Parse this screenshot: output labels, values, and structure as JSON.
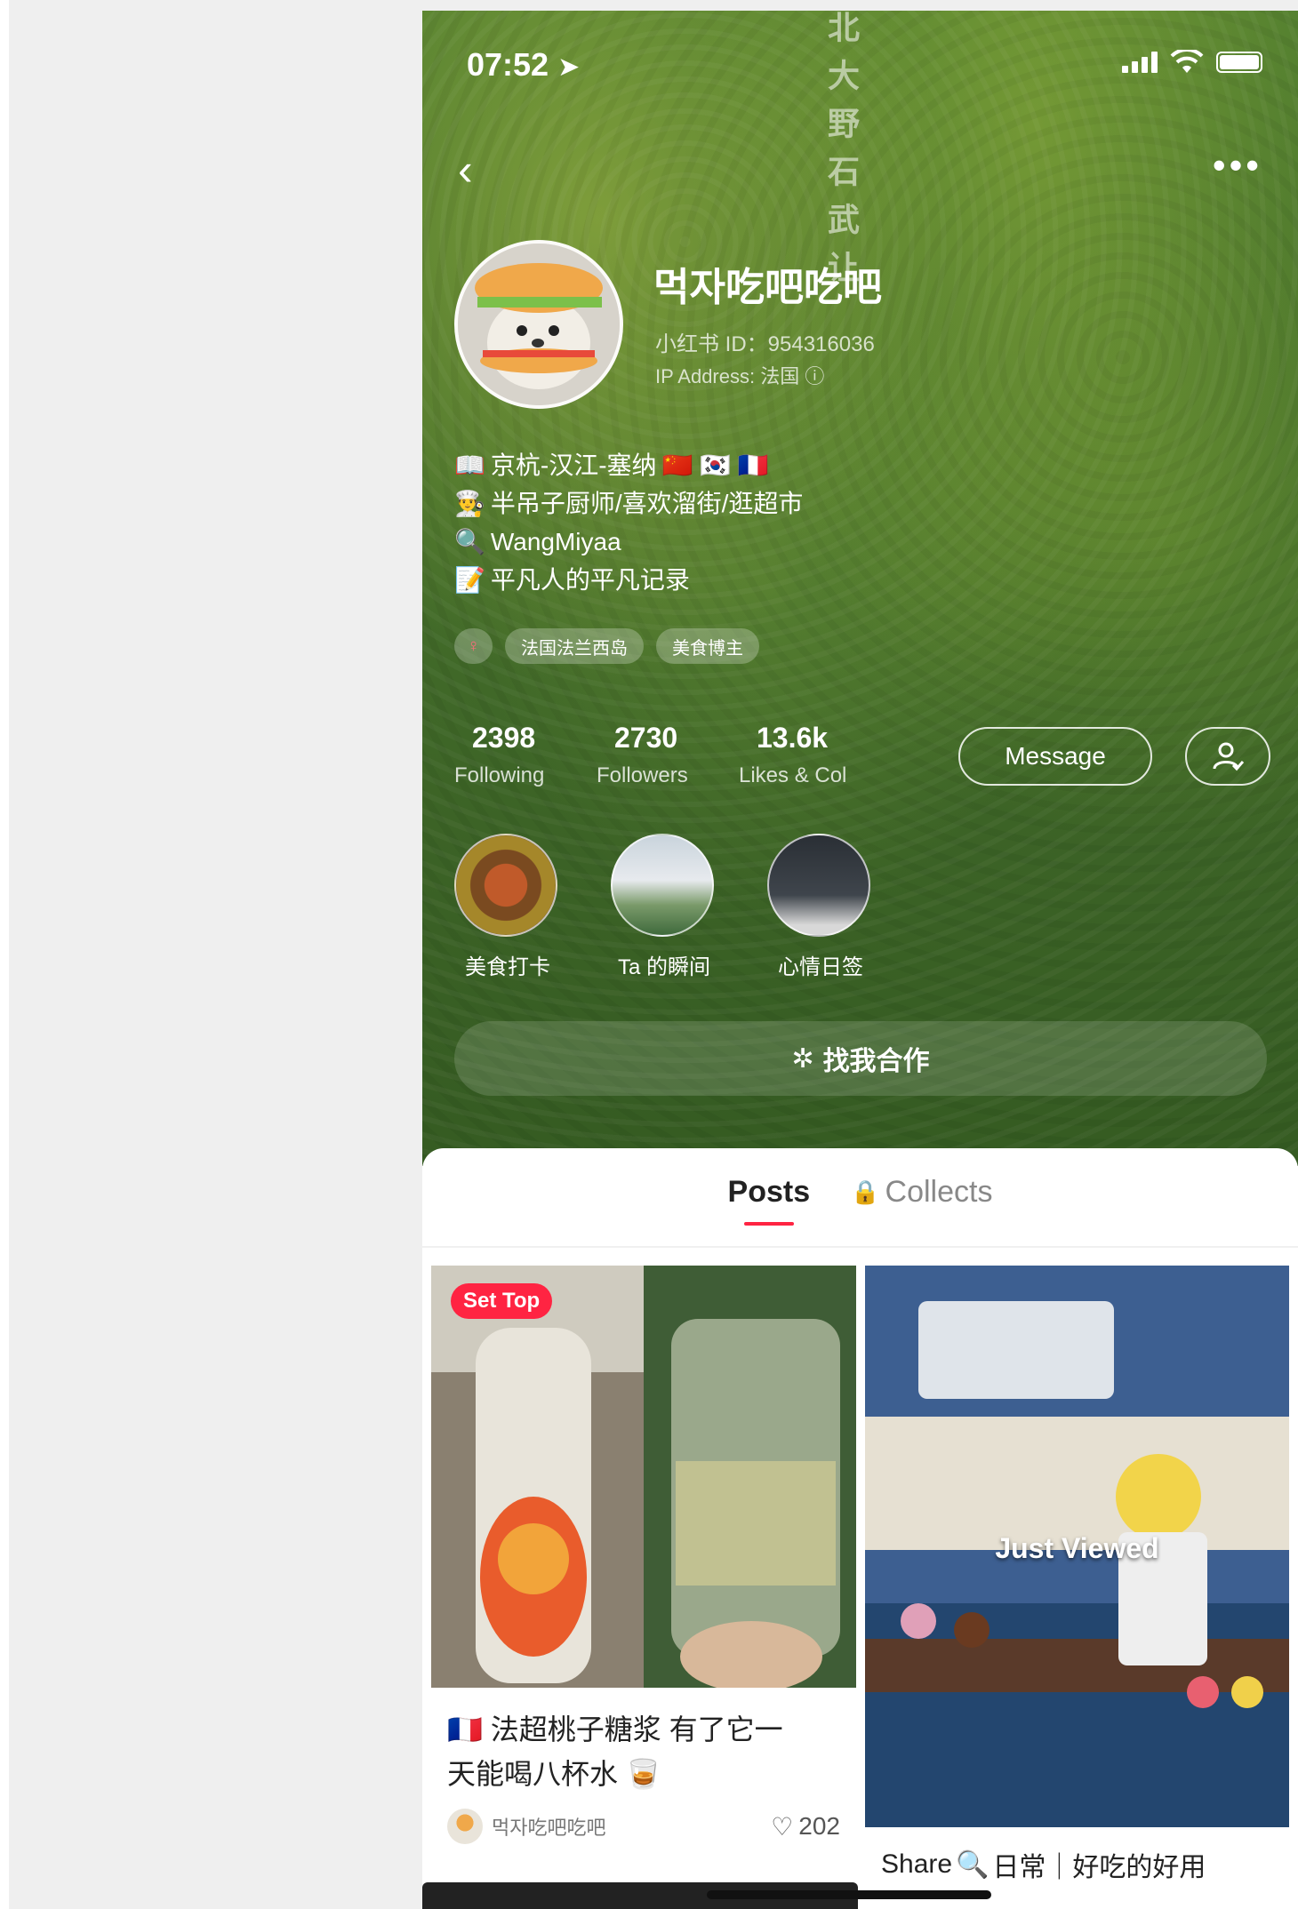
{
  "status": {
    "time": "07:52"
  },
  "poster": {
    "text": "北 大 野 石 武 让"
  },
  "profile": {
    "nickname": "먹자吃吧吃吧",
    "red_id": "小红书 ID：954316036",
    "ip": "IP Address: 法国",
    "bio": [
      "京杭-汉江-塞纳",
      "半吊子厨师/喜欢溜街/逛超市",
      "WangMiyaa",
      "平凡人的平凡记录"
    ],
    "tags": [
      "法国法兰西岛",
      "美食博主"
    ]
  },
  "stats": [
    {
      "num": "2398",
      "label": "Following"
    },
    {
      "num": "2730",
      "label": "Followers"
    },
    {
      "num": "13.6k",
      "label": "Likes & Col"
    }
  ],
  "actions": {
    "message": "Message",
    "collab": "找我合作"
  },
  "highlights": [
    "美食打卡",
    "Ta 的瞬间",
    "心情日签"
  ],
  "tabs": {
    "posts": "Posts",
    "collects": "Collects"
  },
  "notes": [
    {
      "badge": "Set Top",
      "title_line1": "法超桃子糖浆 有了它一",
      "title_line2": "天能喝八杯水",
      "author": "먹자吃吧吃吧",
      "likes": "202"
    },
    {
      "overlay": "Just Viewed",
      "title_prefix": "Share",
      "title": "日常｜好吃的好用"
    }
  ],
  "colors": {
    "accent": "#ff2442",
    "hero_green": "#46702b"
  }
}
